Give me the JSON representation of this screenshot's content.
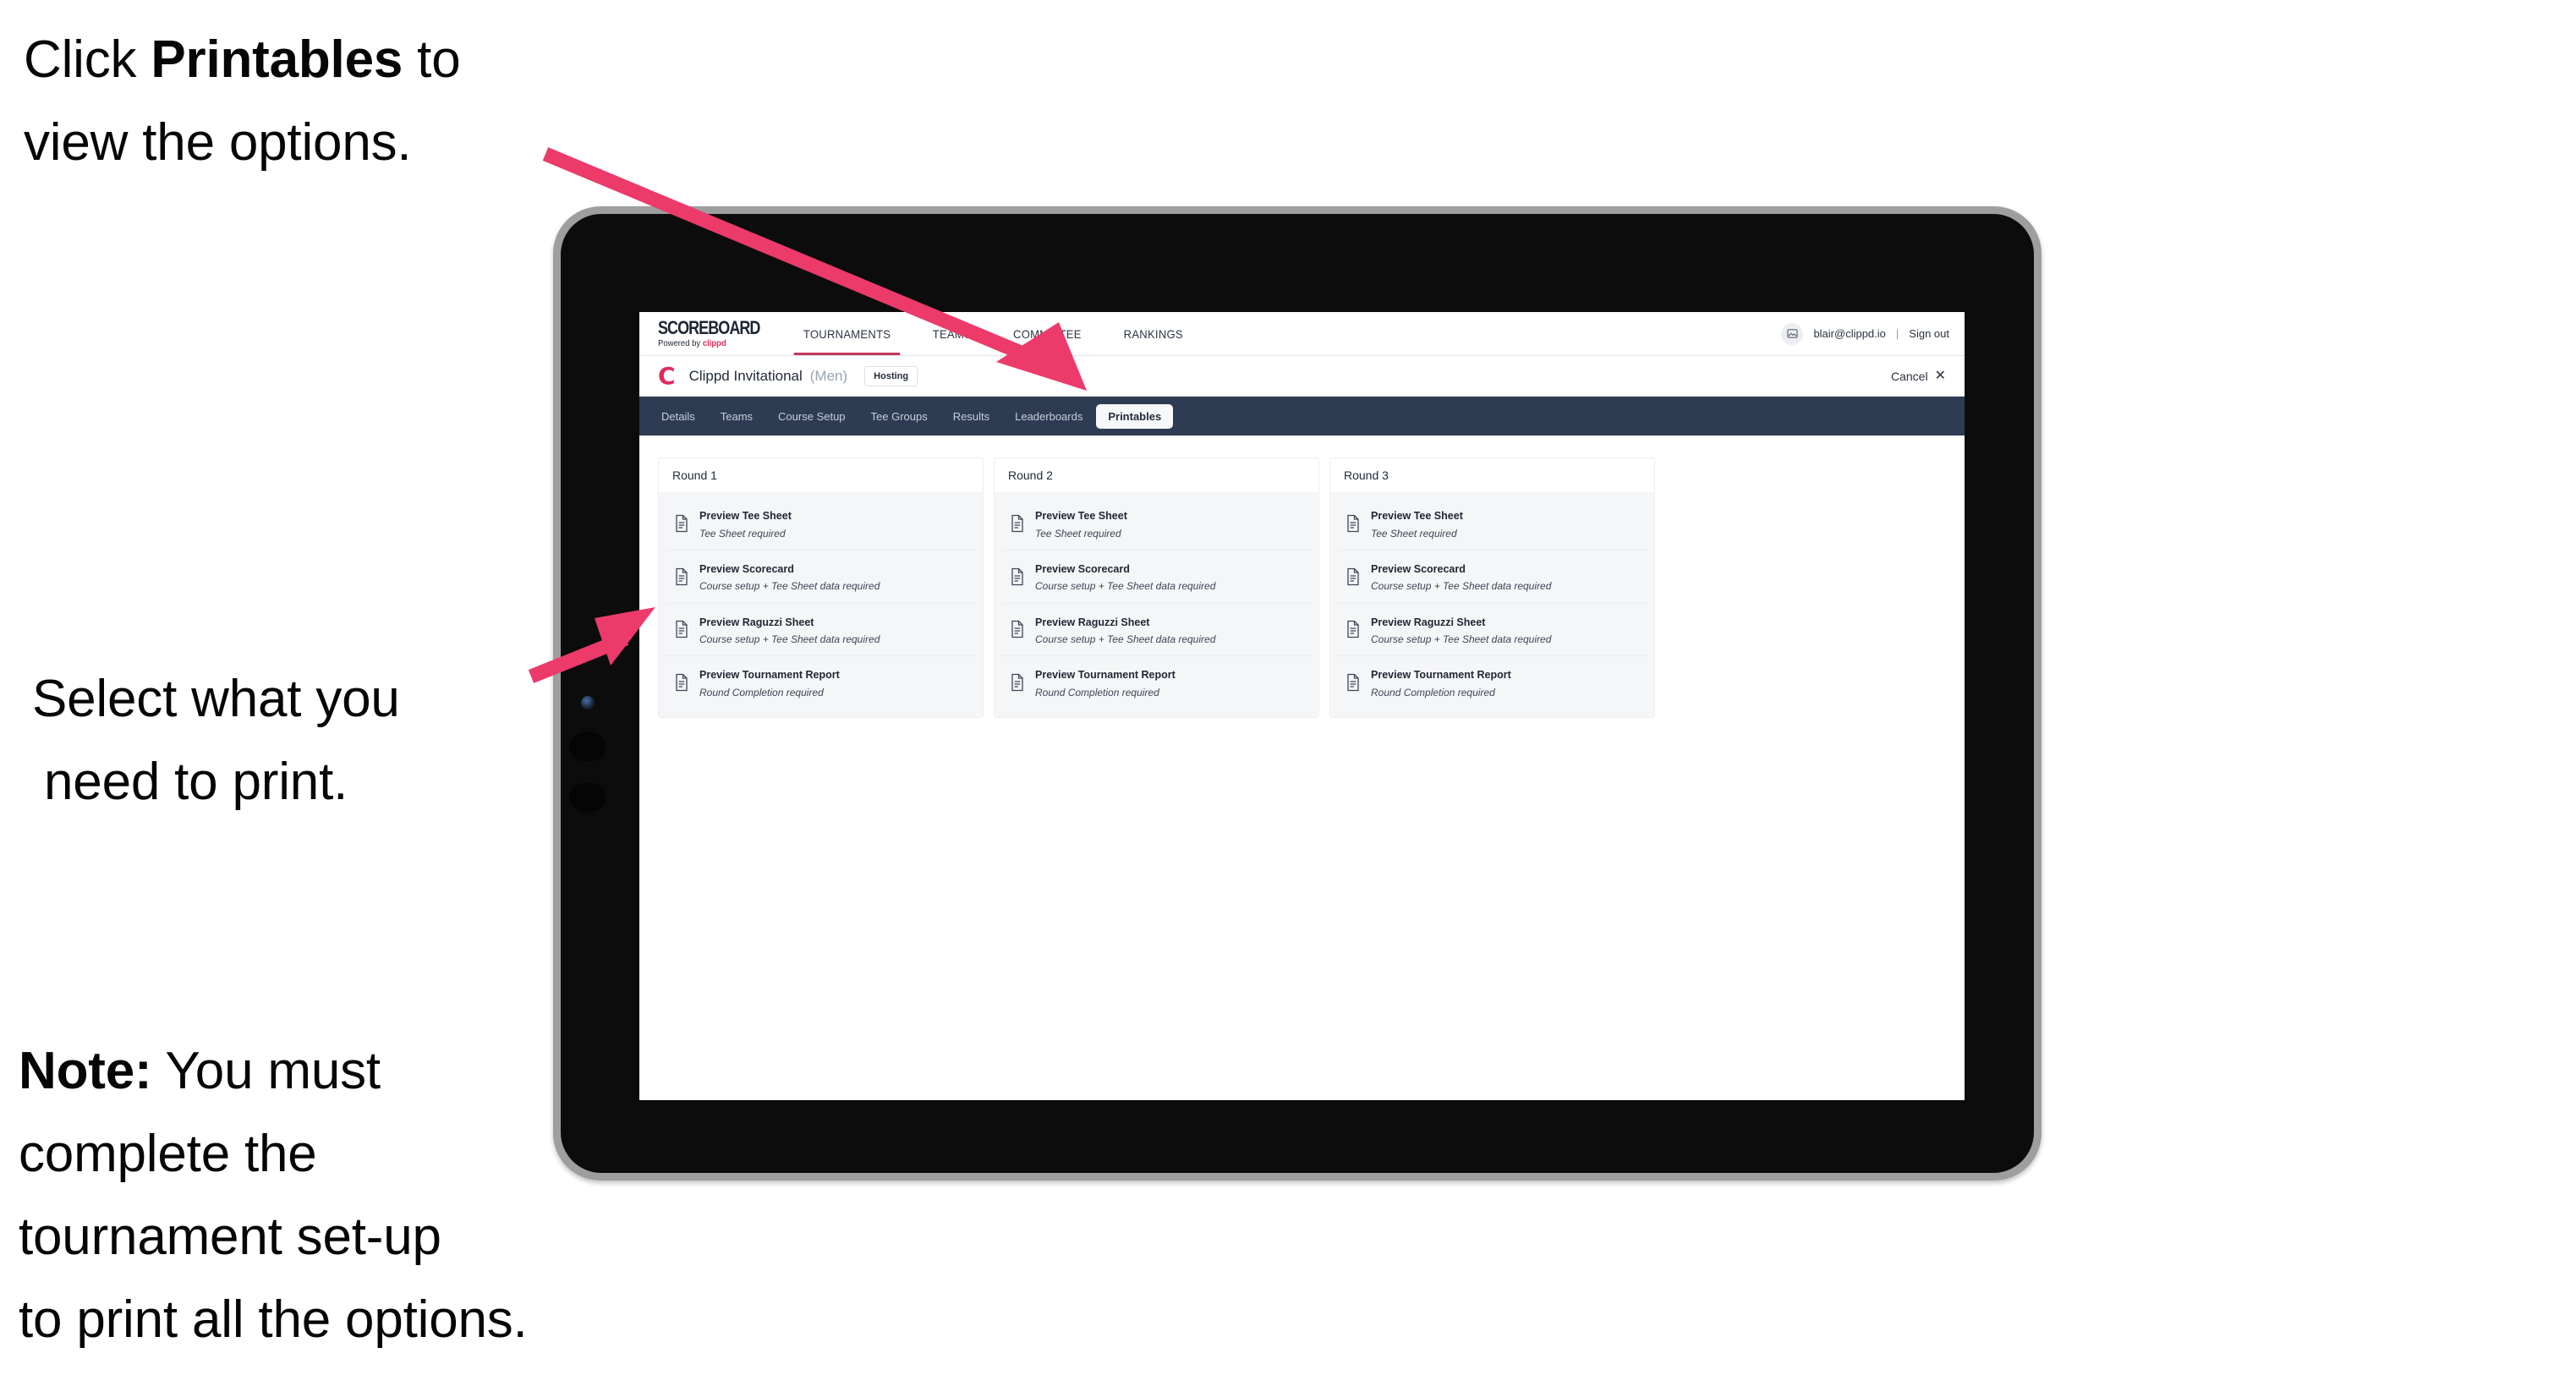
{
  "annotations": {
    "click_line1_pre": "Click ",
    "click_bold": "Printables",
    "click_line1_post": " to",
    "click_line2": "view the options.",
    "select_line1": "Select what you",
    "select_line2": "need to print.",
    "note_bold": "Note:",
    "note_line1_rest": " You must",
    "note_line2": "complete the",
    "note_line3": "tournament set-up",
    "note_line4": "to print all the options."
  },
  "colors": {
    "arrow": "#ec3a6b",
    "brand_pink": "#e12a5b",
    "tabbar_navy": "#2d3b53",
    "tablet_frame": "#9e9e9e",
    "tablet_bezel": "#0c0c0c",
    "card_grey": "#f5f6f8"
  },
  "app": {
    "brand": {
      "wordmark": "SCOREBOARD",
      "tagline_pre": "Powered by ",
      "tagline_brand": "clippd"
    },
    "top_nav": [
      {
        "label": "TOURNAMENTS",
        "active": true
      },
      {
        "label": "TEAMS",
        "active": false
      },
      {
        "label": "COMMITTEE",
        "active": false
      },
      {
        "label": "RANKINGS",
        "active": false
      }
    ],
    "account": {
      "avatar_icon": "user-image-icon",
      "email": "blair@clippd.io",
      "separator": "|",
      "sign_out": "Sign out"
    },
    "tournament": {
      "logo_letter": "C",
      "name": "Clippd Invitational",
      "gender": "(Men)",
      "status_badge": "Hosting",
      "cancel_label": "Cancel",
      "cancel_icon": "close-icon"
    },
    "tabs": [
      {
        "label": "Details",
        "active": false
      },
      {
        "label": "Teams",
        "active": false
      },
      {
        "label": "Course Setup",
        "active": false
      },
      {
        "label": "Tee Groups",
        "active": false
      },
      {
        "label": "Results",
        "active": false
      },
      {
        "label": "Leaderboards",
        "active": false
      },
      {
        "label": "Printables",
        "active": true
      }
    ],
    "rounds": [
      {
        "title": "Round 1",
        "items": [
          {
            "icon": "document-icon",
            "title": "Preview Tee Sheet",
            "subtitle": "Tee Sheet required"
          },
          {
            "icon": "document-icon",
            "title": "Preview Scorecard",
            "subtitle": "Course setup + Tee Sheet data required"
          },
          {
            "icon": "document-icon",
            "title": "Preview Raguzzi Sheet",
            "subtitle": "Course setup + Tee Sheet data required"
          },
          {
            "icon": "document-icon",
            "title": "Preview Tournament Report",
            "subtitle": "Round Completion required"
          }
        ]
      },
      {
        "title": "Round 2",
        "items": [
          {
            "icon": "document-icon",
            "title": "Preview Tee Sheet",
            "subtitle": "Tee Sheet required"
          },
          {
            "icon": "document-icon",
            "title": "Preview Scorecard",
            "subtitle": "Course setup + Tee Sheet data required"
          },
          {
            "icon": "document-icon",
            "title": "Preview Raguzzi Sheet",
            "subtitle": "Course setup + Tee Sheet data required"
          },
          {
            "icon": "document-icon",
            "title": "Preview Tournament Report",
            "subtitle": "Round Completion required"
          }
        ]
      },
      {
        "title": "Round 3",
        "items": [
          {
            "icon": "document-icon",
            "title": "Preview Tee Sheet",
            "subtitle": "Tee Sheet required"
          },
          {
            "icon": "document-icon",
            "title": "Preview Scorecard",
            "subtitle": "Course setup + Tee Sheet data required"
          },
          {
            "icon": "document-icon",
            "title": "Preview Raguzzi Sheet",
            "subtitle": "Course setup + Tee Sheet data required"
          },
          {
            "icon": "document-icon",
            "title": "Preview Tournament Report",
            "subtitle": "Round Completion required"
          }
        ]
      }
    ]
  }
}
